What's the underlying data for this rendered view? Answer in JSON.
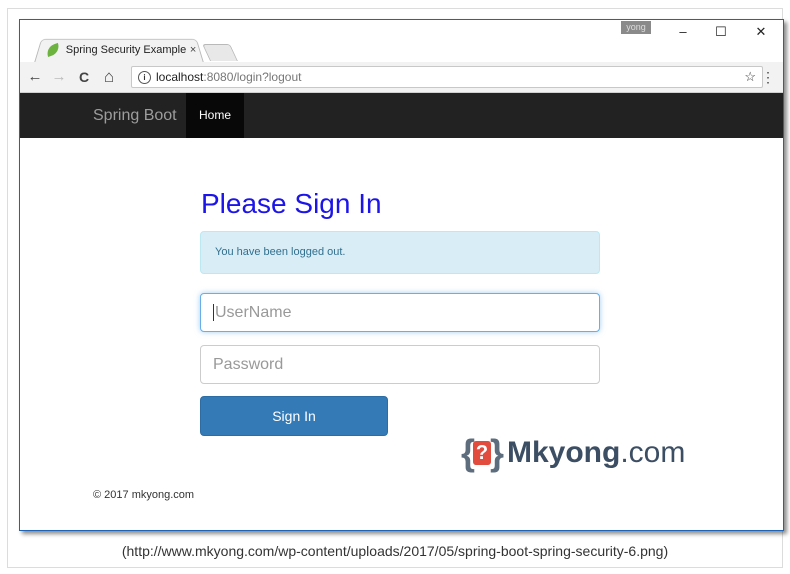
{
  "browser": {
    "tab_title": "Spring Security Example",
    "tab_close": "×",
    "user_badge": "yong",
    "window_controls": {
      "minimize": "–",
      "maximize": "☐",
      "close": "✕"
    },
    "nav": {
      "back": "←",
      "forward": "→",
      "reload": "C",
      "home": "⌂"
    },
    "url_host": "localhost",
    "url_rest": ":8080/login?logout",
    "bookmark_icon": "☆",
    "menu_icon": "⋮"
  },
  "navbar": {
    "brand": "Spring Boot",
    "home": "Home"
  },
  "login": {
    "heading": "Please Sign In",
    "alert": "You have been logged out.",
    "username_placeholder": "UserName",
    "password_placeholder": "Password",
    "submit": "Sign In"
  },
  "watermark": {
    "brace_left": "{",
    "question": "?",
    "brace_right": "}",
    "brand": "Mkyong",
    "suffix": ".com"
  },
  "footer": "© 2017 mkyong.com",
  "caption": "(http://www.mkyong.com/wp-content/uploads/2017/05/spring-boot-spring-security-6.png)",
  "colors": {
    "navbar_bg": "#222222",
    "heading": "#1c14e8",
    "alert_bg": "#d9edf7",
    "button_primary": "#337ab7"
  }
}
